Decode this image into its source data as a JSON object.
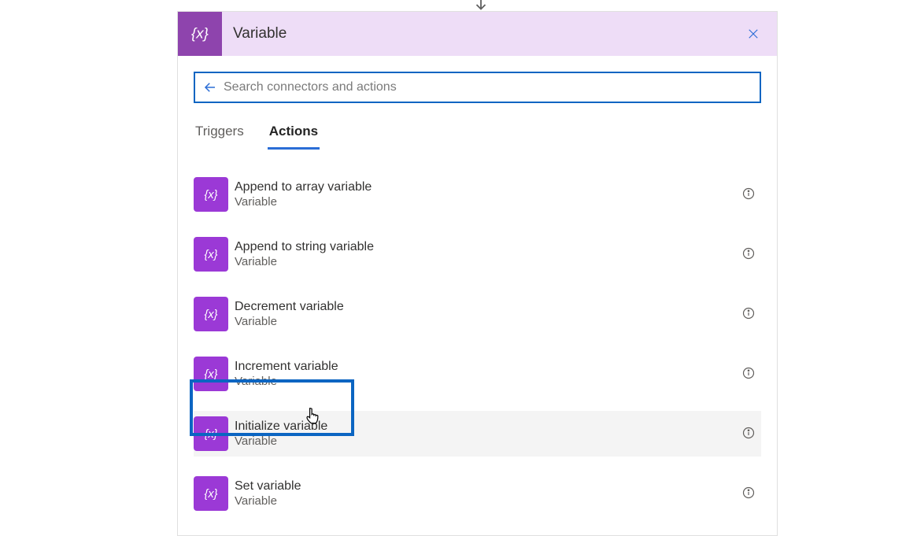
{
  "header": {
    "title": "Variable"
  },
  "search": {
    "placeholder": "Search connectors and actions"
  },
  "tabs": {
    "triggers": "Triggers",
    "actions": "Actions"
  },
  "actions": [
    {
      "title": "Append to array variable",
      "subtitle": "Variable"
    },
    {
      "title": "Append to string variable",
      "subtitle": "Variable"
    },
    {
      "title": "Decrement variable",
      "subtitle": "Variable"
    },
    {
      "title": "Increment variable",
      "subtitle": "Variable"
    },
    {
      "title": "Initialize variable",
      "subtitle": "Variable"
    },
    {
      "title": "Set variable",
      "subtitle": "Variable"
    }
  ]
}
